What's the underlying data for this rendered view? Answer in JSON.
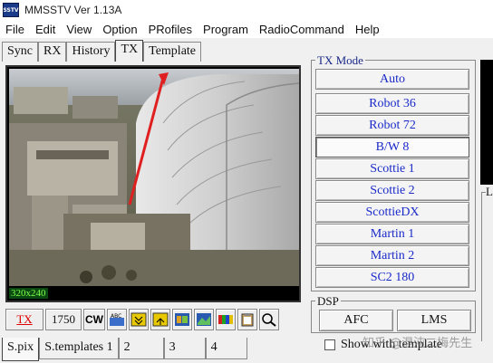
{
  "window": {
    "title": "MMSSTV Ver 1.13A",
    "icon_text": "SSTV"
  },
  "menu": [
    "File",
    "Edit",
    "View",
    "Option",
    "PRofiles",
    "Program",
    "RadioCommand",
    "Help"
  ],
  "tabs": [
    "Sync",
    "RX",
    "History",
    "TX",
    "Template"
  ],
  "active_tab": "TX",
  "picture": {
    "size_label": "320x240",
    "description_icon": "photo-image"
  },
  "toolbar": {
    "tx_label": "TX",
    "freq_label": "1750",
    "cw_label": "CW"
  },
  "tx_mode": {
    "label": "TX Mode",
    "buttons": [
      "Auto",
      "Robot 36",
      "Robot 72",
      "B/W 8",
      "Scottie 1",
      "Scottie 2",
      "ScottieDX",
      "Martin 1",
      "Martin 2",
      "SC2 180"
    ],
    "selected": "B/W 8"
  },
  "dsp": {
    "label": "DSP",
    "afc_label": "AFC",
    "lms_label": "LMS"
  },
  "bottom_tabs": [
    "S.pix",
    "S.templates 1",
    "2",
    "3",
    "4"
  ],
  "show_template_label": "Show with template",
  "right_label": "L",
  "watermark": "知乎 @混沌二梅先生",
  "colors": {
    "tx_red": "#dd0000",
    "mode_blue": "#1a2ac8",
    "arrow_red": "#e02020"
  }
}
